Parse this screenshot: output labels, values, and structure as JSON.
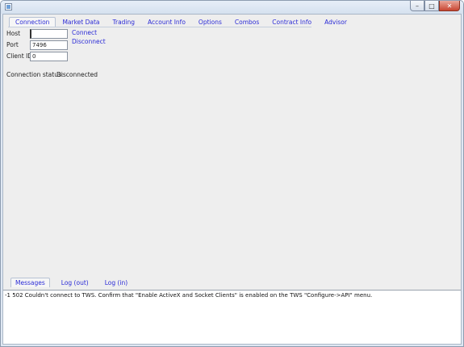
{
  "window": {
    "buttons": [
      "minimize-icon",
      "maximize-icon",
      "close-icon"
    ]
  },
  "tabs": [
    "Connection",
    "Market Data",
    "Trading",
    "Account Info",
    "Options",
    "Combos",
    "Contract Info",
    "Advisor"
  ],
  "connection": {
    "host_label": "Host",
    "host_value": "",
    "port_label": "Port",
    "port_value": "7496",
    "client_id_label": "Client ID",
    "client_id_value": "0",
    "connect_label": "Connect",
    "disconnect_label": "Disconnect",
    "status_label": "Connection status:",
    "status_value": "Disconnected"
  },
  "bottom_tabs": [
    "Messages",
    "Log (out)",
    "Log (in)"
  ],
  "messages": [
    "-1 502 Couldn't connect to TWS.  Confirm that \"Enable ActiveX and Socket Clients\" is enabled on the TWS \"Configure->API\" menu."
  ]
}
